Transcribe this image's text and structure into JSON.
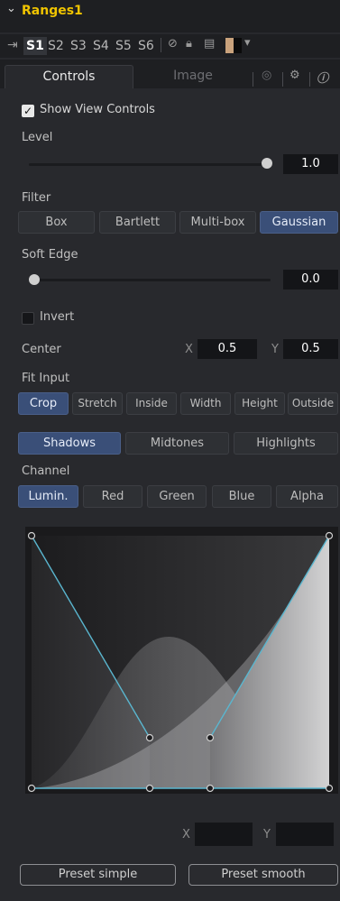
{
  "header": {
    "title": "Ranges1"
  },
  "views": [
    "S1",
    "S2",
    "S3",
    "S4",
    "S5",
    "S6"
  ],
  "tabs": {
    "controls": "Controls",
    "image": "Image"
  },
  "show_view_controls": {
    "label": "Show View Controls",
    "checked": true
  },
  "level": {
    "label": "Level",
    "value": "1.0",
    "fraction": 1.0
  },
  "filter": {
    "label": "Filter",
    "options": [
      "Box",
      "Bartlett",
      "Multi-box",
      "Gaussian"
    ],
    "selected": "Gaussian"
  },
  "soft_edge": {
    "label": "Soft Edge",
    "value": "0.0",
    "fraction": 0.0
  },
  "invert": {
    "label": "Invert",
    "checked": false
  },
  "center": {
    "label": "Center",
    "x_label": "X",
    "x_value": "0.5",
    "y_label": "Y",
    "y_value": "0.5"
  },
  "fit_input": {
    "label": "Fit Input",
    "options": [
      "Crop",
      "Stretch",
      "Inside",
      "Width",
      "Height",
      "Outside"
    ],
    "selected": "Crop"
  },
  "range": {
    "options": [
      "Shadows",
      "Midtones",
      "Highlights"
    ],
    "selected": "Shadows"
  },
  "channel": {
    "label": "Channel",
    "options": [
      "Lumin.",
      "Red",
      "Green",
      "Blue",
      "Alpha"
    ],
    "selected": "Lumin."
  },
  "point": {
    "x_label": "X",
    "y_label": "Y",
    "x_value": "",
    "y_value": ""
  },
  "presets": {
    "simple": "Preset simple",
    "smooth": "Preset smooth"
  },
  "colors": {
    "title": "#f0c400",
    "selected": "#3a4f78",
    "curve": "#5ab6cf"
  }
}
